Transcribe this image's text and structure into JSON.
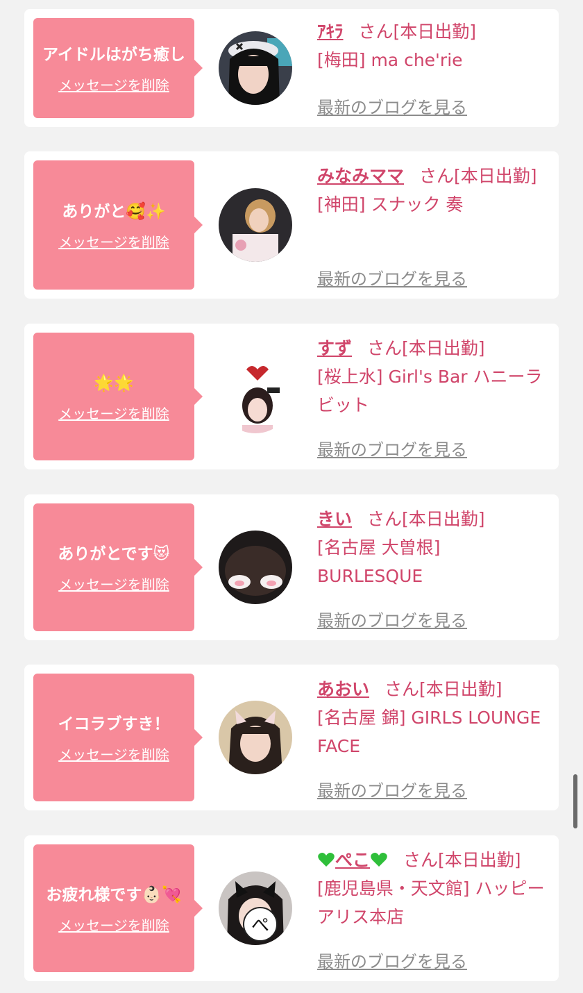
{
  "messages": [
    {
      "message": "アイドルはがち癒し",
      "delete_label": "メッセージを削除",
      "name": "ｱｷﾗ",
      "suffix": "さん[本日出勤]",
      "shop": "[梅田] ma che'rie",
      "blog_label": "最新のブログを見る"
    },
    {
      "message": "ありがと🥰✨",
      "delete_label": "メッセージを削除",
      "name": "みなみママ",
      "suffix": "さん[本日出勤]",
      "shop": "[神田] スナック 奏",
      "blog_label": "最新のブログを見る"
    },
    {
      "message": "🌟🌟",
      "delete_label": "メッセージを削除",
      "name": "すず",
      "suffix": "さん[本日出勤]",
      "shop": "[桜上水] Girl's Bar ハニーラビット",
      "blog_label": "最新のブログを見る"
    },
    {
      "message": "ありがとです😻",
      "delete_label": "メッセージを削除",
      "name": "きい",
      "suffix": "さん[本日出勤]",
      "shop": "[名古屋 大曽根] BURLESQUE",
      "blog_label": "最新のブログを見る"
    },
    {
      "message": "イコラブすき！",
      "delete_label": "メッセージを削除",
      "name": "あおい",
      "suffix": "さん[本日出勤]",
      "shop": "[名古屋 錦] GIRLS LOUNGE FACE",
      "blog_label": "最新のブログを見る"
    },
    {
      "message": "お疲れ様です👶🏻💘",
      "delete_label": "メッセージを削除",
      "name": "ぺこ",
      "name_decoration": "green-heart-icon",
      "suffix": "さん[本日出勤]",
      "shop": "[鹿児島県・天文館] ハッピーアリス本店",
      "blog_label": "最新のブログを見る",
      "avatar_badge": "ぺ"
    }
  ],
  "colors": {
    "background": "#f2f2f2",
    "card": "#ffffff",
    "bubble": "#f78a98",
    "accent_text": "#d0456a",
    "link_gray": "#8c8c8c",
    "green_heart": "#2fbf3a"
  }
}
